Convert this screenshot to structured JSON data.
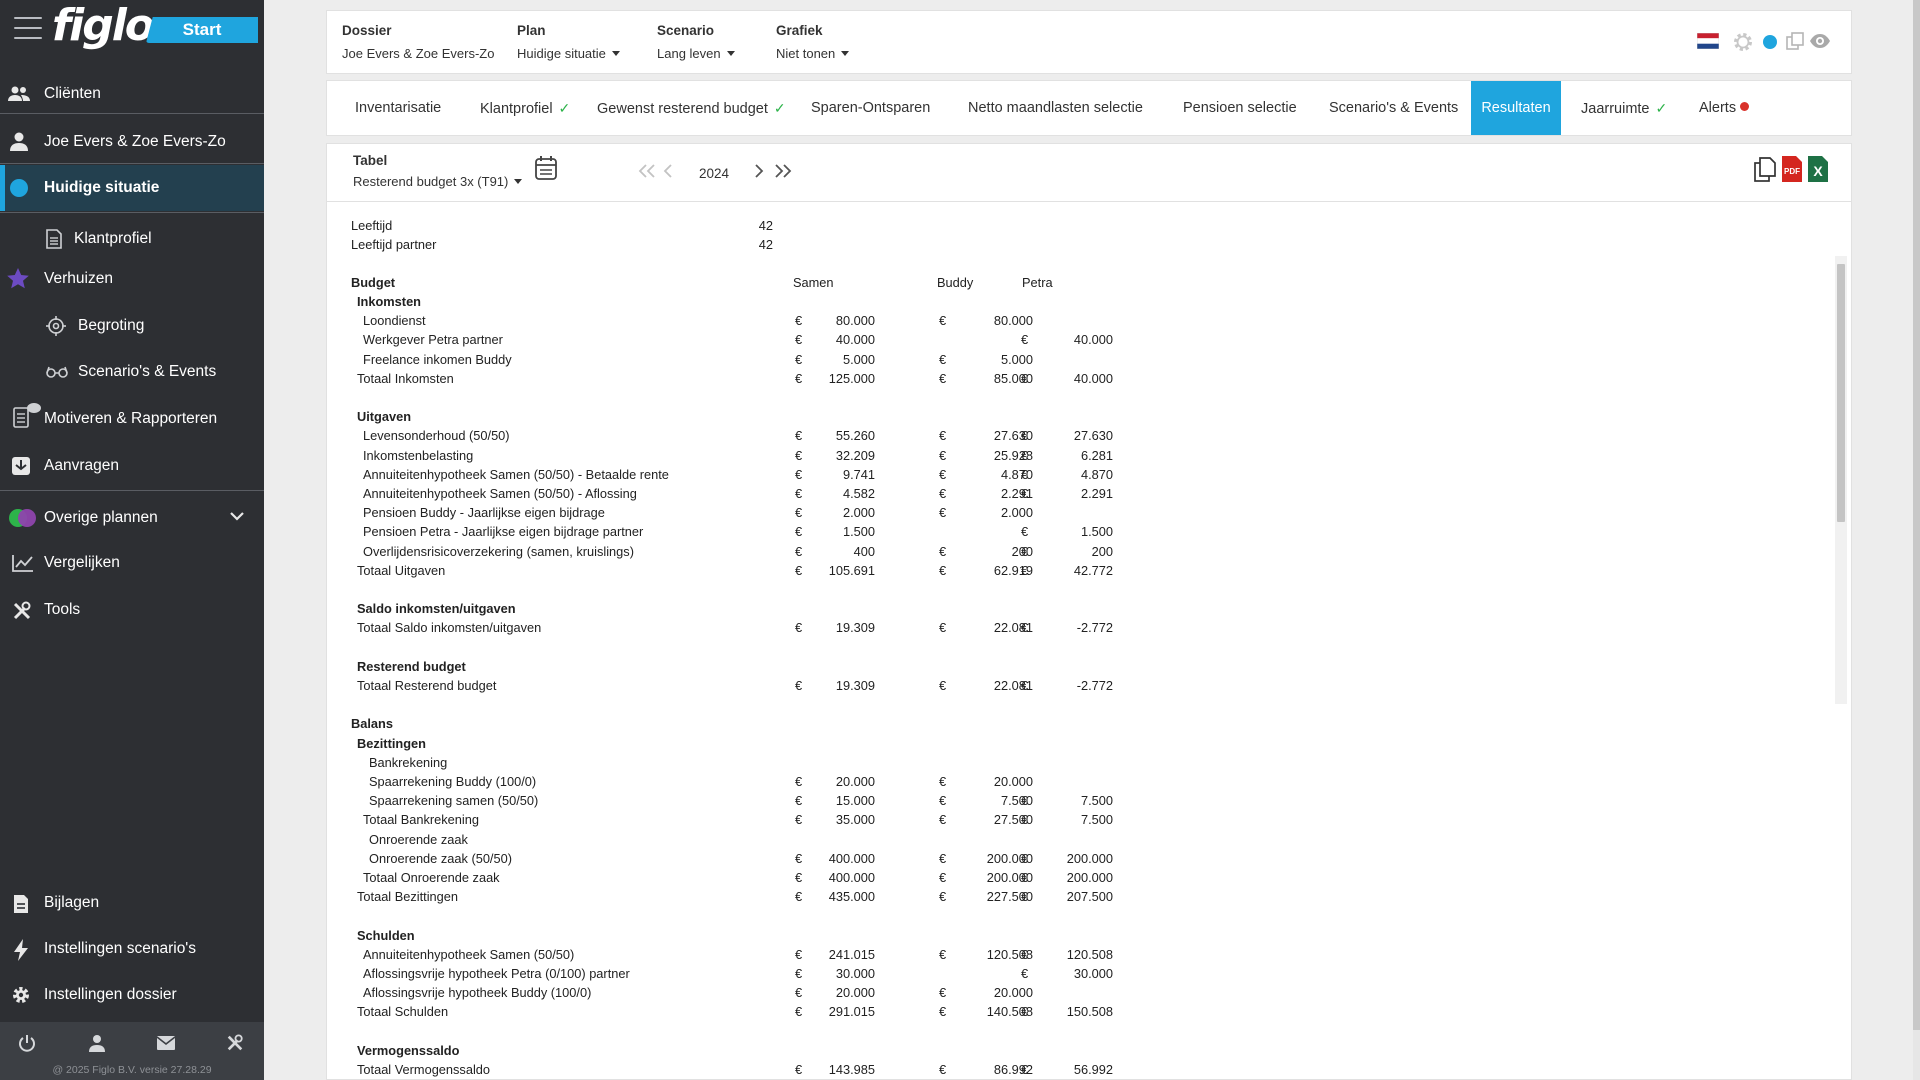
{
  "sidebar": {
    "logo": "figlo",
    "start_label": "Start",
    "items": [
      {
        "label": "Cliënten",
        "icon": "users-icon"
      },
      {
        "label": "Joe Evers & Zoe Evers-Zo",
        "icon": "user-icon"
      },
      {
        "label": "Huidige situatie",
        "icon": "blue-dot-icon"
      },
      {
        "label": "Klantprofiel",
        "icon": "document-icon"
      },
      {
        "label": "Verhuizen",
        "icon": "star-icon"
      },
      {
        "label": "Begroting",
        "icon": "crosshair-icon"
      },
      {
        "label": "Scenario's & Events",
        "icon": "glasses-icon"
      },
      {
        "label": "Motiveren & Rapporteren",
        "icon": "report-icon"
      },
      {
        "label": "Aanvragen",
        "icon": "inbox-icon"
      },
      {
        "label": "Overige plannen",
        "icon": "plans-icon"
      },
      {
        "label": "Vergelijken",
        "icon": "chart-line-icon"
      },
      {
        "label": "Tools",
        "icon": "tools-icon"
      },
      {
        "label": "Bijlagen",
        "icon": "file-icon"
      },
      {
        "label": "Instellingen scenario's",
        "icon": "bolt-icon"
      },
      {
        "label": "Instellingen dossier",
        "icon": "gear-icon"
      }
    ],
    "copyright": "@ 2025 Figlo B.V. versie 27.28.29",
    "colors": {
      "active_bg": "#23404f",
      "accent": "#1fa5de"
    }
  },
  "topbar": {
    "dossier_label": "Dossier",
    "dossier_value": "Joe Evers & Zoe Evers-Zo",
    "plan_label": "Plan",
    "plan_value": "Huidige situatie",
    "scenario_label": "Scenario",
    "scenario_value": "Lang leven",
    "grafiek_label": "Grafiek",
    "grafiek_value": "Niet tonen"
  },
  "tabs": [
    {
      "label": "Inventarisatie",
      "check": false
    },
    {
      "label": "Klantprofiel",
      "check": true
    },
    {
      "label": "Gewenst resterend budget",
      "check": true
    },
    {
      "label": "Sparen-Ontsparen",
      "check": false
    },
    {
      "label": "Netto maandlasten selectie",
      "check": false
    },
    {
      "label": "Pensioen selectie",
      "check": false
    },
    {
      "label": "Scenario's & Events",
      "check": false
    },
    {
      "label": "Resultaten",
      "check": false,
      "active": true
    },
    {
      "label": "Jaarruimte",
      "check": true
    },
    {
      "label": "Alerts",
      "check": false,
      "alert": true
    }
  ],
  "controls": {
    "tabel_label": "Tabel",
    "tabel_value": "Resterend budget 3x (T91)",
    "year": "2024"
  },
  "report": {
    "leeftijd_label": "Leeftijd",
    "leeftijd_value": "42",
    "leeftijd_partner_label": "Leeftijd partner",
    "leeftijd_partner_value": "42",
    "headers": {
      "budget": "Budget",
      "samen": "Samen",
      "buddy": "Buddy",
      "petra": "Petra"
    },
    "currency": "€",
    "rows": [
      {
        "label": "Inkomsten",
        "bold": true,
        "indent": 1
      },
      {
        "label": "Loondienst",
        "indent": 2,
        "samen": "80.000",
        "buddy": "80.000",
        "petra": ""
      },
      {
        "label": "Werkgever Petra partner",
        "indent": 2,
        "samen": "40.000",
        "buddy": "",
        "petra": "40.000"
      },
      {
        "label": "Freelance inkomen Buddy",
        "indent": 2,
        "samen": "5.000",
        "buddy": "5.000",
        "petra": ""
      },
      {
        "label": "Totaal Inkomsten",
        "indent": 1,
        "samen": "125.000",
        "buddy": "85.000",
        "petra": "40.000"
      },
      {
        "label": "",
        "spacer": true
      },
      {
        "label": "Uitgaven",
        "bold": true,
        "indent": 1
      },
      {
        "label": "Levensonderhoud (50/50)",
        "indent": 2,
        "samen": "55.260",
        "buddy": "27.630",
        "petra": "27.630"
      },
      {
        "label": "Inkomstenbelasting",
        "indent": 2,
        "samen": "32.209",
        "buddy": "25.928",
        "petra": "6.281"
      },
      {
        "label": "Annuiteitenhypotheek Samen (50/50) - Betaalde rente",
        "indent": 2,
        "samen": "9.741",
        "buddy": "4.870",
        "petra": "4.870"
      },
      {
        "label": "Annuiteitenhypotheek Samen (50/50) - Aflossing",
        "indent": 2,
        "samen": "4.582",
        "buddy": "2.291",
        "petra": "2.291"
      },
      {
        "label": "Pensioen Buddy - Jaarlijkse eigen bijdrage",
        "indent": 2,
        "samen": "2.000",
        "buddy": "2.000",
        "petra": ""
      },
      {
        "label": "Pensioen Petra - Jaarlijkse eigen bijdrage partner",
        "indent": 2,
        "samen": "1.500",
        "buddy": "",
        "petra": "1.500"
      },
      {
        "label": "Overlijdensrisicoverzekering (samen, kruislings)",
        "indent": 2,
        "samen": "400",
        "buddy": "200",
        "petra": "200"
      },
      {
        "label": "Totaal Uitgaven",
        "indent": 1,
        "samen": "105.691",
        "buddy": "62.919",
        "petra": "42.772"
      },
      {
        "label": "",
        "spacer": true
      },
      {
        "label": "Saldo inkomsten/uitgaven",
        "bold": true,
        "indent": 1
      },
      {
        "label": "Totaal Saldo inkomsten/uitgaven",
        "indent": 1,
        "samen": "19.309",
        "buddy": "22.081",
        "petra": "-2.772"
      },
      {
        "label": "",
        "spacer": true
      },
      {
        "label": "Resterend budget",
        "bold": true,
        "indent": 1
      },
      {
        "label": "Totaal Resterend budget",
        "indent": 1,
        "samen": "19.309",
        "buddy": "22.081",
        "petra": "-2.772"
      },
      {
        "label": "",
        "spacer": true
      },
      {
        "label": "Balans",
        "bold": true,
        "indent": 0
      },
      {
        "label": "Bezittingen",
        "bold": true,
        "indent": 1
      },
      {
        "label": "Bankrekening",
        "indent": 3
      },
      {
        "label": "Spaarrekening Buddy (100/0)",
        "indent": 3,
        "samen": "20.000",
        "buddy": "20.000",
        "petra": ""
      },
      {
        "label": "Spaarrekening samen (50/50)",
        "indent": 3,
        "samen": "15.000",
        "buddy": "7.500",
        "petra": "7.500"
      },
      {
        "label": "Totaal Bankrekening",
        "indent": 2,
        "samen": "35.000",
        "buddy": "27.500",
        "petra": "7.500"
      },
      {
        "label": "Onroerende zaak",
        "indent": 3
      },
      {
        "label": "Onroerende zaak (50/50)",
        "indent": 3,
        "samen": "400.000",
        "buddy": "200.000",
        "petra": "200.000"
      },
      {
        "label": "Totaal Onroerende zaak",
        "indent": 2,
        "samen": "400.000",
        "buddy": "200.000",
        "petra": "200.000"
      },
      {
        "label": "Totaal Bezittingen",
        "indent": 1,
        "samen": "435.000",
        "buddy": "227.500",
        "petra": "207.500"
      },
      {
        "label": "",
        "spacer": true
      },
      {
        "label": "Schulden",
        "bold": true,
        "indent": 1
      },
      {
        "label": "Annuiteitenhypotheek Samen (50/50)",
        "indent": 2,
        "samen": "241.015",
        "buddy": "120.508",
        "petra": "120.508"
      },
      {
        "label": "Aflossingsvrije hypotheek Petra (0/100) partner",
        "indent": 2,
        "samen": "30.000",
        "buddy": "",
        "petra": "30.000"
      },
      {
        "label": "Aflossingsvrije hypotheek Buddy (100/0)",
        "indent": 2,
        "samen": "20.000",
        "buddy": "20.000",
        "petra": ""
      },
      {
        "label": "Totaal Schulden",
        "indent": 1,
        "samen": "291.015",
        "buddy": "140.508",
        "petra": "150.508"
      },
      {
        "label": "",
        "spacer": true
      },
      {
        "label": "Vermogenssaldo",
        "bold": true,
        "indent": 1
      },
      {
        "label": "Totaal Vermogenssaldo",
        "indent": 1,
        "samen": "143.985",
        "buddy": "86.992",
        "petra": "56.992"
      }
    ]
  }
}
